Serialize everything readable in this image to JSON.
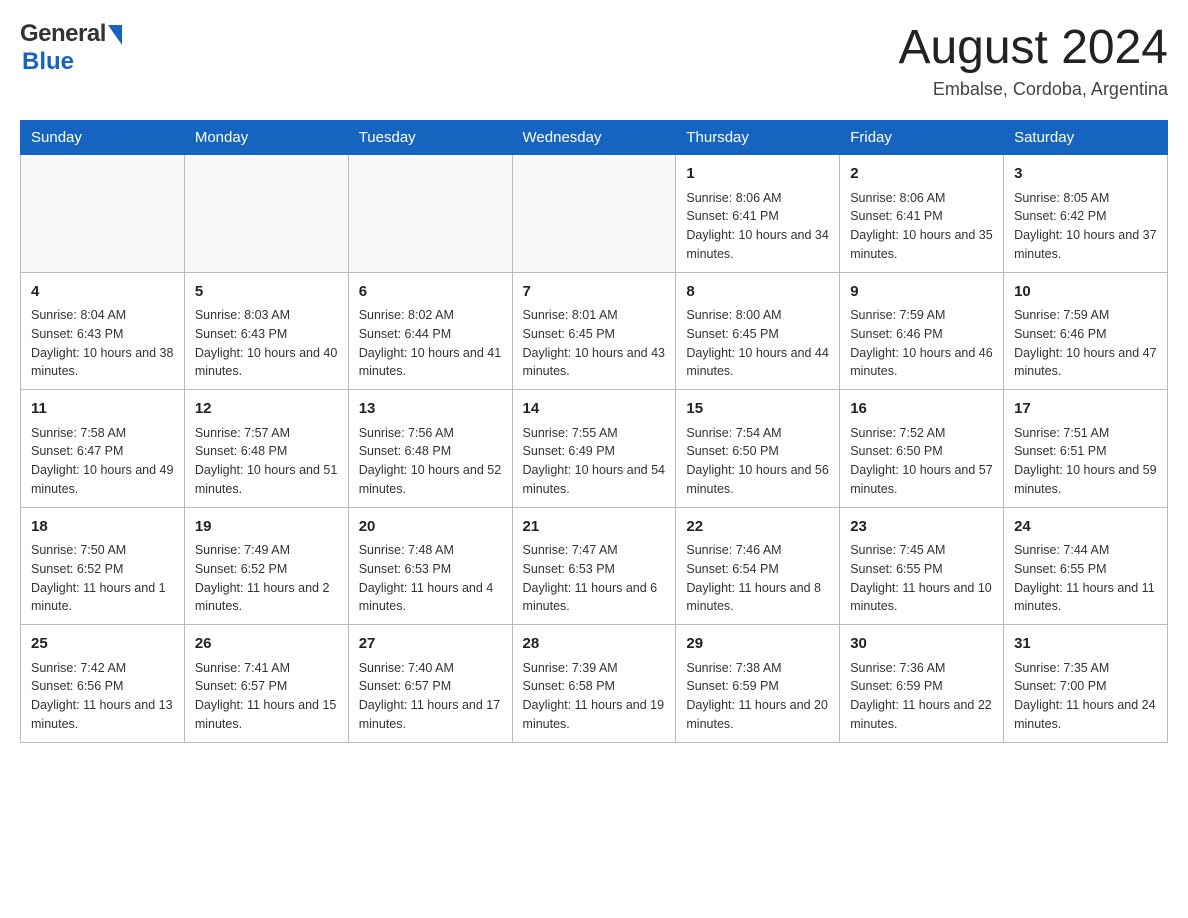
{
  "header": {
    "logo_general": "General",
    "logo_blue": "Blue",
    "title": "August 2024",
    "location": "Embalse, Cordoba, Argentina"
  },
  "weekdays": [
    "Sunday",
    "Monday",
    "Tuesday",
    "Wednesday",
    "Thursday",
    "Friday",
    "Saturday"
  ],
  "weeks": [
    [
      {
        "day": "",
        "info": ""
      },
      {
        "day": "",
        "info": ""
      },
      {
        "day": "",
        "info": ""
      },
      {
        "day": "",
        "info": ""
      },
      {
        "day": "1",
        "info": "Sunrise: 8:06 AM\nSunset: 6:41 PM\nDaylight: 10 hours and 34 minutes."
      },
      {
        "day": "2",
        "info": "Sunrise: 8:06 AM\nSunset: 6:41 PM\nDaylight: 10 hours and 35 minutes."
      },
      {
        "day": "3",
        "info": "Sunrise: 8:05 AM\nSunset: 6:42 PM\nDaylight: 10 hours and 37 minutes."
      }
    ],
    [
      {
        "day": "4",
        "info": "Sunrise: 8:04 AM\nSunset: 6:43 PM\nDaylight: 10 hours and 38 minutes."
      },
      {
        "day": "5",
        "info": "Sunrise: 8:03 AM\nSunset: 6:43 PM\nDaylight: 10 hours and 40 minutes."
      },
      {
        "day": "6",
        "info": "Sunrise: 8:02 AM\nSunset: 6:44 PM\nDaylight: 10 hours and 41 minutes."
      },
      {
        "day": "7",
        "info": "Sunrise: 8:01 AM\nSunset: 6:45 PM\nDaylight: 10 hours and 43 minutes."
      },
      {
        "day": "8",
        "info": "Sunrise: 8:00 AM\nSunset: 6:45 PM\nDaylight: 10 hours and 44 minutes."
      },
      {
        "day": "9",
        "info": "Sunrise: 7:59 AM\nSunset: 6:46 PM\nDaylight: 10 hours and 46 minutes."
      },
      {
        "day": "10",
        "info": "Sunrise: 7:59 AM\nSunset: 6:46 PM\nDaylight: 10 hours and 47 minutes."
      }
    ],
    [
      {
        "day": "11",
        "info": "Sunrise: 7:58 AM\nSunset: 6:47 PM\nDaylight: 10 hours and 49 minutes."
      },
      {
        "day": "12",
        "info": "Sunrise: 7:57 AM\nSunset: 6:48 PM\nDaylight: 10 hours and 51 minutes."
      },
      {
        "day": "13",
        "info": "Sunrise: 7:56 AM\nSunset: 6:48 PM\nDaylight: 10 hours and 52 minutes."
      },
      {
        "day": "14",
        "info": "Sunrise: 7:55 AM\nSunset: 6:49 PM\nDaylight: 10 hours and 54 minutes."
      },
      {
        "day": "15",
        "info": "Sunrise: 7:54 AM\nSunset: 6:50 PM\nDaylight: 10 hours and 56 minutes."
      },
      {
        "day": "16",
        "info": "Sunrise: 7:52 AM\nSunset: 6:50 PM\nDaylight: 10 hours and 57 minutes."
      },
      {
        "day": "17",
        "info": "Sunrise: 7:51 AM\nSunset: 6:51 PM\nDaylight: 10 hours and 59 minutes."
      }
    ],
    [
      {
        "day": "18",
        "info": "Sunrise: 7:50 AM\nSunset: 6:52 PM\nDaylight: 11 hours and 1 minute."
      },
      {
        "day": "19",
        "info": "Sunrise: 7:49 AM\nSunset: 6:52 PM\nDaylight: 11 hours and 2 minutes."
      },
      {
        "day": "20",
        "info": "Sunrise: 7:48 AM\nSunset: 6:53 PM\nDaylight: 11 hours and 4 minutes."
      },
      {
        "day": "21",
        "info": "Sunrise: 7:47 AM\nSunset: 6:53 PM\nDaylight: 11 hours and 6 minutes."
      },
      {
        "day": "22",
        "info": "Sunrise: 7:46 AM\nSunset: 6:54 PM\nDaylight: 11 hours and 8 minutes."
      },
      {
        "day": "23",
        "info": "Sunrise: 7:45 AM\nSunset: 6:55 PM\nDaylight: 11 hours and 10 minutes."
      },
      {
        "day": "24",
        "info": "Sunrise: 7:44 AM\nSunset: 6:55 PM\nDaylight: 11 hours and 11 minutes."
      }
    ],
    [
      {
        "day": "25",
        "info": "Sunrise: 7:42 AM\nSunset: 6:56 PM\nDaylight: 11 hours and 13 minutes."
      },
      {
        "day": "26",
        "info": "Sunrise: 7:41 AM\nSunset: 6:57 PM\nDaylight: 11 hours and 15 minutes."
      },
      {
        "day": "27",
        "info": "Sunrise: 7:40 AM\nSunset: 6:57 PM\nDaylight: 11 hours and 17 minutes."
      },
      {
        "day": "28",
        "info": "Sunrise: 7:39 AM\nSunset: 6:58 PM\nDaylight: 11 hours and 19 minutes."
      },
      {
        "day": "29",
        "info": "Sunrise: 7:38 AM\nSunset: 6:59 PM\nDaylight: 11 hours and 20 minutes."
      },
      {
        "day": "30",
        "info": "Sunrise: 7:36 AM\nSunset: 6:59 PM\nDaylight: 11 hours and 22 minutes."
      },
      {
        "day": "31",
        "info": "Sunrise: 7:35 AM\nSunset: 7:00 PM\nDaylight: 11 hours and 24 minutes."
      }
    ]
  ]
}
